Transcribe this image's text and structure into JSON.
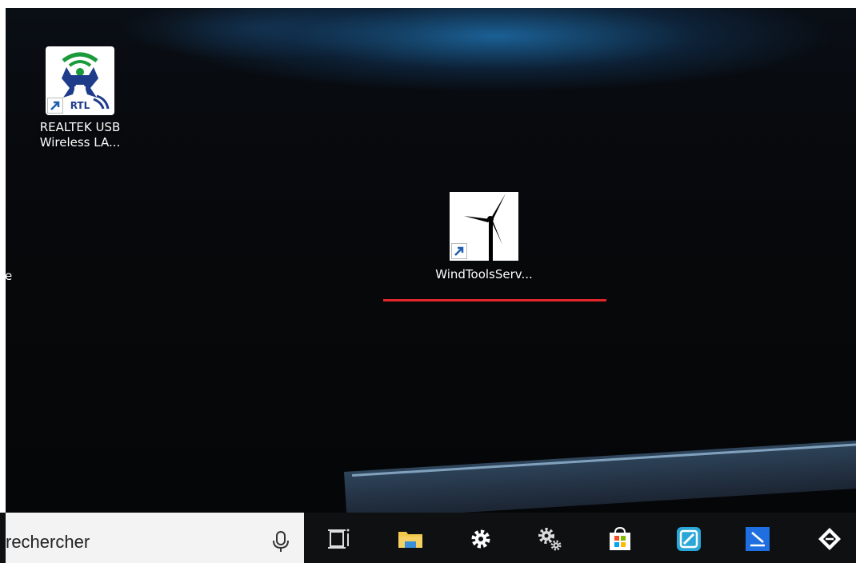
{
  "desktop": {
    "icons": [
      {
        "label_line1": "REALTEK USB",
        "label_line2": "Wireless LA...",
        "icon": "realtek-wifi-icon"
      },
      {
        "label": "WindToolsServ...",
        "icon": "wind-turbine-icon"
      }
    ],
    "edge_text": "e"
  },
  "taskbar": {
    "search_text": "rechercher",
    "icons": [
      "microphone-icon",
      "task-view-icon",
      "file-explorer-icon",
      "settings-icon",
      "settings-gears-icon",
      "store-icon",
      "app-icon",
      "app-icon-2",
      "app-icon-3"
    ]
  },
  "colors": {
    "accent_red": "#e0262a"
  }
}
